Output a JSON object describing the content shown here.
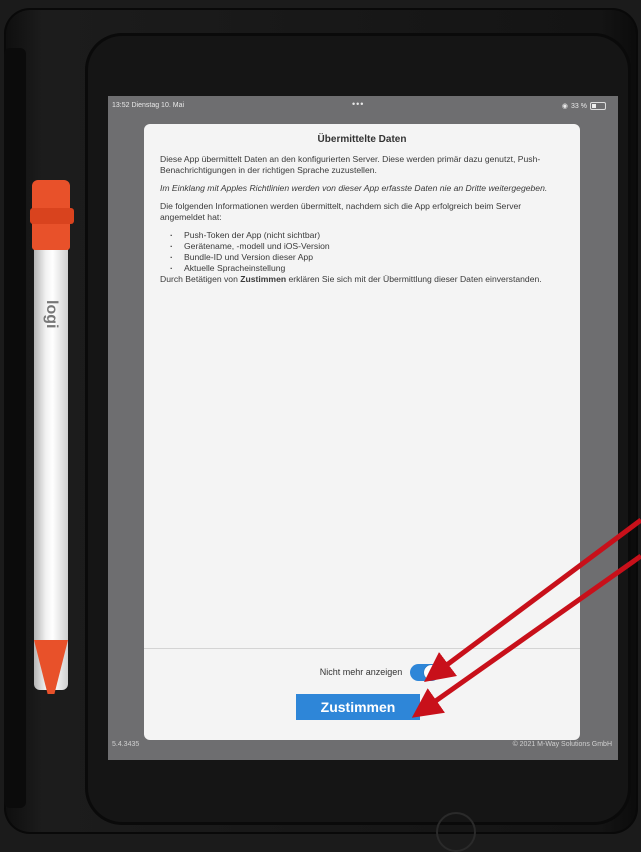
{
  "status_bar": {
    "time": "13:52",
    "date": "Dienstag 10. Mai",
    "dots": "•••",
    "battery": "33 %"
  },
  "modal": {
    "title": "Übermittelte Daten",
    "p1": "Diese App übermittelt Daten an den konfigurierten Server. Diese werden primär dazu genutzt, Push-Benachrichtigungen in der richtigen Sprache zuzustellen.",
    "p2": "Im Einklang mit Apples Richtlinien werden von dieser App erfasste Daten nie an Dritte weitergegeben.",
    "p3": "Die folgenden Informationen werden übermittelt, nachdem sich die App erfolgreich beim Server angemeldet hat:",
    "items": [
      "Push-Token der App (nicht sichtbar)",
      "Gerätename, -modell und iOS-Version",
      "Bundle-ID und Version dieser App",
      "Aktuelle Spracheinstellung"
    ],
    "consent_prefix": "Durch Betätigen von ",
    "consent_bold": "Zustimmen",
    "consent_suffix": " erklären Sie sich mit der Übermittlung dieser Daten einverstanden.",
    "toggle_label": "Nicht mehr anzeigen",
    "toggle_on": true,
    "agree_label": "Zustimmen"
  },
  "footer": {
    "version": "5.4.3435",
    "copyright": "© 2021 M-Way Solutions GmbH"
  },
  "pencil_logo": "logi",
  "colors": {
    "accent": "#2e86d8",
    "annotation": "#c8101a",
    "pencil": "#e8512a"
  }
}
